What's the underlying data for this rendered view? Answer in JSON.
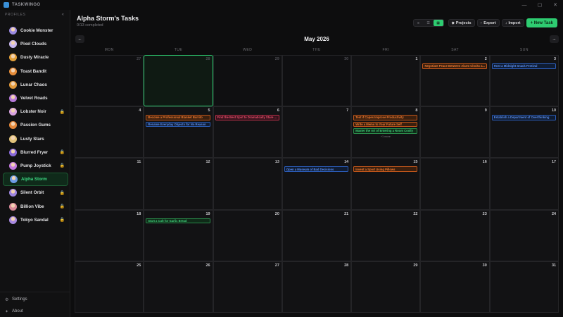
{
  "app": {
    "name": "TASKWINGO"
  },
  "window": {
    "minimize": "—",
    "maximize": "▢",
    "close": "✕"
  },
  "sidebar": {
    "profiles_label": "PROFILES",
    "collapse_icon": "«",
    "profiles": [
      {
        "name": "Cookie Monster",
        "locked": false,
        "active": false,
        "color": "#9b8ae0"
      },
      {
        "name": "Pixel Clouds",
        "locked": false,
        "active": false,
        "color": "#c9b8f0"
      },
      {
        "name": "Dusty Miracle",
        "locked": false,
        "active": false,
        "color": "#e3a03a"
      },
      {
        "name": "Toast Bandit",
        "locked": false,
        "active": false,
        "color": "#e58c3a"
      },
      {
        "name": "Lunar Chaos",
        "locked": false,
        "active": false,
        "color": "#e39a3a"
      },
      {
        "name": "Velvet Roads",
        "locked": false,
        "active": false,
        "color": "#b77ad9"
      },
      {
        "name": "Lobster Noir",
        "locked": true,
        "active": false,
        "color": "#d9a3e0"
      },
      {
        "name": "Passion Gums",
        "locked": false,
        "active": false,
        "color": "#e5883a"
      },
      {
        "name": "Lusty Stars",
        "locked": false,
        "active": false,
        "color": "#e2c37a"
      },
      {
        "name": "Blurred Fryer",
        "locked": true,
        "active": false,
        "color": "#8a6ad9"
      },
      {
        "name": "Pump Joystick",
        "locked": true,
        "active": false,
        "color": "#c47ae0"
      },
      {
        "name": "Alpha Storm",
        "locked": false,
        "active": true,
        "color": "#6c9ae6"
      },
      {
        "name": "Silent Orbit",
        "locked": true,
        "active": false,
        "color": "#9f86e0"
      },
      {
        "name": "Billion Vibe",
        "locked": true,
        "active": false,
        "color": "#d98a9a"
      },
      {
        "name": "Tokyo Sandal",
        "locked": true,
        "active": false,
        "color": "#a98ae0"
      }
    ],
    "lock_icon": "🔒",
    "footer": {
      "settings": "Settings",
      "about": "About",
      "settings_icon": "⚙",
      "about_icon": "✦"
    }
  },
  "main": {
    "title": "Alpha Storm's Tasks",
    "subtitle": "0/13 completed",
    "toolbar": {
      "projects": "Projects",
      "export": "Export",
      "import": "Import",
      "new_task": "+ New Task",
      "projects_icon": "◆",
      "export_icon": "↑",
      "import_icon": "↓"
    }
  },
  "calendar": {
    "month": "May 2026",
    "prev": "←",
    "next": "→",
    "weekdays": [
      "MON",
      "TUE",
      "WED",
      "THU",
      "FRI",
      "SAT",
      "SUN"
    ],
    "weeks": [
      [
        {
          "day": "27",
          "other": true,
          "tasks": []
        },
        {
          "day": "28",
          "other": true,
          "today": true,
          "tasks": []
        },
        {
          "day": "29",
          "other": true,
          "tasks": []
        },
        {
          "day": "30",
          "other": true,
          "tasks": []
        },
        {
          "day": "1",
          "tasks": []
        },
        {
          "day": "2",
          "tasks": [
            {
              "text": "Negotiate Peace Between Alarm Clocks a...",
              "color": "orange"
            }
          ]
        },
        {
          "day": "3",
          "tasks": [
            {
              "text": "Host a Midnight Snack Festival",
              "color": "blue"
            }
          ]
        }
      ],
      [
        {
          "day": "4",
          "tasks": []
        },
        {
          "day": "5",
          "tasks": [
            {
              "text": "Become a Professional Blanket Burrito",
              "color": "orange"
            },
            {
              "text": "Rename Everyday Objects for No Reason",
              "color": "blue"
            }
          ]
        },
        {
          "day": "6",
          "tasks": [
            {
              "text": "Find the Best Spot to Dramatically Stare ...",
              "color": "red"
            }
          ]
        },
        {
          "day": "7",
          "tasks": []
        },
        {
          "day": "8",
          "tasks": [
            {
              "text": "Test if Capes Improve Productivity",
              "color": "orange"
            },
            {
              "text": "Write a Memo to Your Future Self",
              "color": "orange"
            },
            {
              "text": "Master the Art of Entering a Room Coolly",
              "color": "green"
            }
          ],
          "more": "+1 more"
        },
        {
          "day": "9",
          "tasks": []
        },
        {
          "day": "10",
          "tasks": [
            {
              "text": "Establish a Department of Overthinking",
              "color": "blue"
            }
          ]
        }
      ],
      [
        {
          "day": "11",
          "tasks": []
        },
        {
          "day": "12",
          "tasks": []
        },
        {
          "day": "13",
          "tasks": []
        },
        {
          "day": "14",
          "tasks": [
            {
              "text": "Open a Museum of Bad Decisions",
              "color": "blue"
            }
          ]
        },
        {
          "day": "15",
          "tasks": [
            {
              "text": "Invent a Sport Using Pillows",
              "color": "orange"
            }
          ]
        },
        {
          "day": "16",
          "tasks": []
        },
        {
          "day": "17",
          "tasks": []
        }
      ],
      [
        {
          "day": "18",
          "tasks": []
        },
        {
          "day": "19",
          "tasks": [
            {
              "text": "Start a Cult for Garlic Bread",
              "color": "green"
            }
          ]
        },
        {
          "day": "20",
          "tasks": []
        },
        {
          "day": "21",
          "tasks": []
        },
        {
          "day": "22",
          "tasks": []
        },
        {
          "day": "23",
          "tasks": []
        },
        {
          "day": "24",
          "tasks": []
        }
      ],
      [
        {
          "day": "25",
          "tasks": []
        },
        {
          "day": "26",
          "tasks": []
        },
        {
          "day": "27",
          "tasks": []
        },
        {
          "day": "28",
          "tasks": []
        },
        {
          "day": "29",
          "tasks": []
        },
        {
          "day": "30",
          "tasks": []
        },
        {
          "day": "31",
          "tasks": []
        }
      ]
    ]
  }
}
